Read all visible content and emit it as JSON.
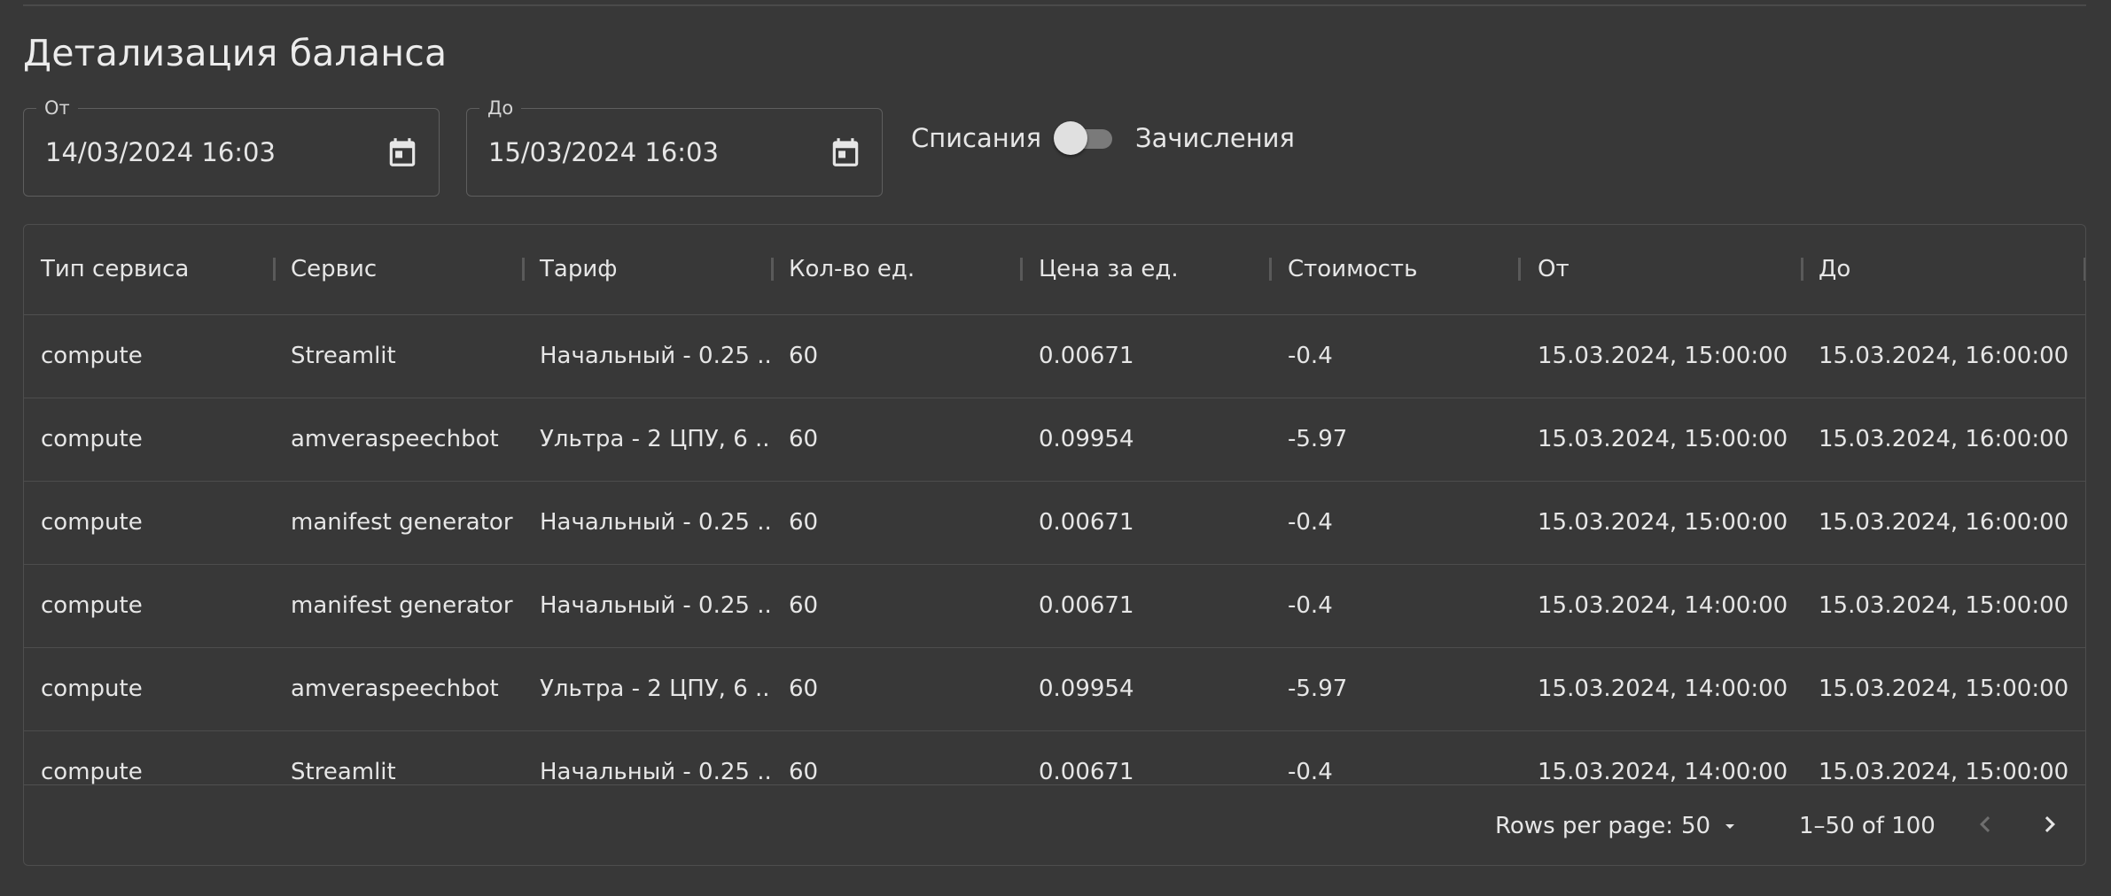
{
  "page": {
    "title": "Детализация баланса"
  },
  "filters": {
    "from": {
      "label": "От",
      "value": "14/03/2024 16:03",
      "icon": "calendar-icon"
    },
    "to": {
      "label": "До",
      "value": "15/03/2024 16:03",
      "icon": "calendar-icon"
    },
    "toggle": {
      "left_label": "Списания",
      "right_label": "Зачисления",
      "checked": false
    }
  },
  "table": {
    "columns": [
      "Тип сервиса",
      "Сервис",
      "Тариф",
      "Кол-во ед.",
      "Цена за ед.",
      "Стоимость",
      "От",
      "До"
    ],
    "rows": [
      [
        "compute",
        "Streamlit",
        "Начальный - 0.25 ...",
        "60",
        "0.00671",
        "-0.4",
        "15.03.2024, 15:00:00",
        "15.03.2024, 16:00:00"
      ],
      [
        "compute",
        "amveraspeechbot",
        "Ультра - 2 ЦПУ, 6 ...",
        "60",
        "0.09954",
        "-5.97",
        "15.03.2024, 15:00:00",
        "15.03.2024, 16:00:00"
      ],
      [
        "compute",
        "manifest generator",
        "Начальный - 0.25 ...",
        "60",
        "0.00671",
        "-0.4",
        "15.03.2024, 15:00:00",
        "15.03.2024, 16:00:00"
      ],
      [
        "compute",
        "manifest generator",
        "Начальный - 0.25 ...",
        "60",
        "0.00671",
        "-0.4",
        "15.03.2024, 14:00:00",
        "15.03.2024, 15:00:00"
      ],
      [
        "compute",
        "amveraspeechbot",
        "Ультра - 2 ЦПУ, 6 ...",
        "60",
        "0.09954",
        "-5.97",
        "15.03.2024, 14:00:00",
        "15.03.2024, 15:00:00"
      ],
      [
        "compute",
        "Streamlit",
        "Начальный - 0.25 ...",
        "60",
        "0.00671",
        "-0.4",
        "15.03.2024, 14:00:00",
        "15.03.2024, 15:00:00"
      ]
    ]
  },
  "pagination": {
    "rows_per_page_label": "Rows per page:",
    "rows_per_page_value": "50",
    "range_text": "1–50 of 100",
    "prev_icon": "chevron-left-icon",
    "next_icon": "chevron-right-icon"
  },
  "colors": {
    "background": "#383838",
    "text": "#e6e6e6",
    "border": "#4e4e4e"
  }
}
